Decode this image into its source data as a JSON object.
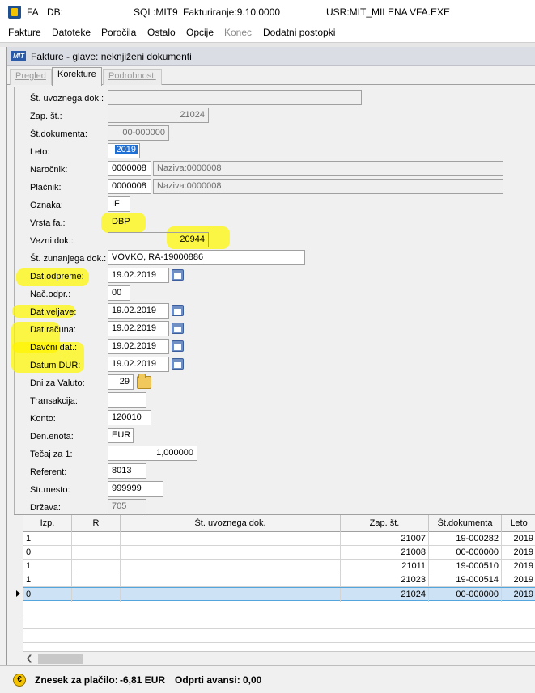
{
  "titlebar": {
    "app": "FA",
    "db": "DB:",
    "sql": "SQL:MIT9",
    "version": "Fakturiranje:9.10.0000",
    "user": "USR:MIT_MILENA",
    "exe": "VFA.EXE"
  },
  "menu": [
    {
      "label": "Fakture",
      "enabled": true
    },
    {
      "label": "Datoteke",
      "enabled": true
    },
    {
      "label": "Poročila",
      "enabled": true
    },
    {
      "label": "Ostalo",
      "enabled": true
    },
    {
      "label": "Opcije",
      "enabled": true
    },
    {
      "label": "Konec",
      "enabled": false
    },
    {
      "label": "Dodatni postopki",
      "enabled": true
    }
  ],
  "window": {
    "logo": "MIT",
    "title": "Fakture - glave: neknjiženi dokumenti"
  },
  "tabs": [
    {
      "label": "Pregled",
      "active": false
    },
    {
      "label": "Korekture",
      "active": true
    },
    {
      "label": "Podrobnosti",
      "active": false
    }
  ],
  "form": {
    "st_uvoznega_dok": {
      "label": "Št. uvoznega dok.:",
      "value": ""
    },
    "zap_st": {
      "label": "Zap. št.:",
      "value": "21024"
    },
    "st_dokumenta": {
      "label": "Št.dokumenta:",
      "value": "00-000000"
    },
    "leto": {
      "label": "Leto:",
      "value": "2019"
    },
    "narocnik": {
      "label": "Naročnik:",
      "code": "0000008",
      "name": "Naziva:0000008"
    },
    "placnik": {
      "label": "Plačnik:",
      "code": "0000008",
      "name": "Naziva:0000008"
    },
    "oznaka": {
      "label": "Oznaka:",
      "value": "IF"
    },
    "vrsta_fa": {
      "label": "Vrsta fa.:",
      "value": "DBP"
    },
    "vezni_dok": {
      "label": "Vezni dok.:",
      "value": "20944"
    },
    "st_zunanjega_dok": {
      "label": "Št. zunanjega dok.:",
      "value": "VOVKO, RA-19000886"
    },
    "dat_odpreme": {
      "label": "Dat.odpreme:",
      "value": "19.02.2019"
    },
    "nac_odpr": {
      "label": "Nač.odpr.:",
      "value": "00"
    },
    "dat_veljave": {
      "label": "Dat.veljave:",
      "value": "19.02.2019"
    },
    "dat_racuna": {
      "label": "Dat.računa:",
      "value": "19.02.2019"
    },
    "davcni_dat": {
      "label": "Davčni dat.:",
      "value": "19.02.2019"
    },
    "datum_dur": {
      "label": "Datum DUR:",
      "value": "19.02.2019"
    },
    "dni_za_valuto": {
      "label": "Dni za Valuto:",
      "value": "29"
    },
    "transakcija": {
      "label": "Transakcija:",
      "value": ""
    },
    "konto": {
      "label": "Konto:",
      "value": "120010"
    },
    "den_enota": {
      "label": "Den.enota:",
      "value": "EUR"
    },
    "tecaj": {
      "label": "Tečaj za 1:",
      "value": "1,000000"
    },
    "referent": {
      "label": "Referent:",
      "value": "8013"
    },
    "str_mesto": {
      "label": "Str.mesto:",
      "value": "999999"
    },
    "drzava": {
      "label": "Država:",
      "value": "705"
    }
  },
  "grid": {
    "columns": [
      "Izp.",
      "R",
      "Št. uvoznega dok.",
      "Zap. št.",
      "Št.dokumenta",
      "Leto"
    ],
    "rows": [
      {
        "izp": "1",
        "r": "",
        "uvoz": "",
        "zap": "21007",
        "dok": "19-000282",
        "leto": "2019"
      },
      {
        "izp": "0",
        "r": "",
        "uvoz": "",
        "zap": "21008",
        "dok": "00-000000",
        "leto": "2019"
      },
      {
        "izp": "1",
        "r": "",
        "uvoz": "",
        "zap": "21011",
        "dok": "19-000510",
        "leto": "2019"
      },
      {
        "izp": "1",
        "r": "",
        "uvoz": "",
        "zap": "21023",
        "dok": "19-000514",
        "leto": "2019"
      },
      {
        "izp": "0",
        "r": "",
        "uvoz": "",
        "zap": "21024",
        "dok": "00-000000",
        "leto": "2019"
      }
    ],
    "selected_row": 4
  },
  "status": {
    "znesek_label": "Znesek za plačilo:",
    "znesek_value": "-6,81 EUR",
    "avansi_label": "Odprti avansi:",
    "avansi_value": "0,00"
  },
  "colors": {
    "highlighter": "#fff600",
    "selection": "#1e6fd6",
    "row_selected": "#cde2f4"
  }
}
